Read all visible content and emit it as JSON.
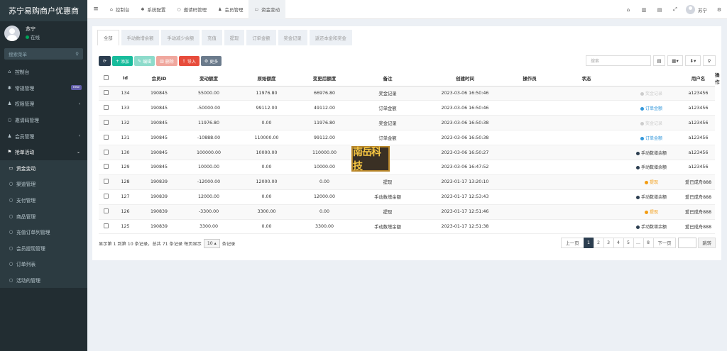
{
  "brand": "苏宁易购商户优惠商",
  "user": {
    "name": "苏宁",
    "status": "在线"
  },
  "search_placeholder": "搜索菜单",
  "menu": [
    {
      "icon": "⌂",
      "label": "控制台"
    },
    {
      "icon": "✱",
      "label": "常规管理",
      "badge": "new"
    },
    {
      "icon": "♟",
      "label": "权限管理",
      "chev": "‹"
    },
    {
      "icon": "○",
      "label": "邀请码管理"
    },
    {
      "icon": "♟",
      "label": "会员管理",
      "chev": "‹"
    },
    {
      "icon": "⚑",
      "label": "抢单活动",
      "chev": "⌄"
    },
    {
      "icon": "▭",
      "label": "资金变动"
    },
    {
      "icon": "○",
      "label": "渠道管理"
    },
    {
      "icon": "○",
      "label": "支付管理"
    },
    {
      "icon": "○",
      "label": "商品管理"
    },
    {
      "icon": "○",
      "label": "充值订单列管理"
    },
    {
      "icon": "○",
      "label": "会员提现管理"
    },
    {
      "icon": "○",
      "label": "订单列表"
    },
    {
      "icon": "○",
      "label": "活动的管理"
    }
  ],
  "topnav": [
    {
      "icon": "⌂",
      "label": "控制台"
    },
    {
      "icon": "✱",
      "label": "系统配置"
    },
    {
      "icon": "○",
      "label": "邀请码管理"
    },
    {
      "icon": "♟",
      "label": "会员管理"
    },
    {
      "icon": "▭",
      "label": "资金变动"
    }
  ],
  "topright": {
    "icons": [
      "home-icon",
      "trash-icon",
      "comment-icon",
      "expand-icon"
    ],
    "username": "苏宁",
    "gear": "cog-icon"
  },
  "tabs": [
    "全部",
    "手动数增余额",
    "手动减少余额",
    "充值",
    "提现",
    "订单金额",
    "奖金记录",
    "返还本金和奖金"
  ],
  "toolbar": {
    "add": "添加",
    "edit": "编辑",
    "delete": "删除",
    "import": "导入",
    "more": "更多"
  },
  "table_search_placeholder": "搜索",
  "columns": [
    "Id",
    "会员ID",
    "变动额度",
    "原始额度",
    "变更后额度",
    "备注",
    "创建时间",
    "操作员",
    "状态",
    "用户名",
    "操作"
  ],
  "rows": [
    {
      "id": "134",
      "uid": "190845",
      "change": "55000.00",
      "orig": "11976.80",
      "after": "66976.80",
      "note": "奖金记录",
      "time": "2023-03-06 16:50:46",
      "op": "",
      "status": "奖金记录",
      "stype": "gray",
      "user": "a123456"
    },
    {
      "id": "133",
      "uid": "190845",
      "change": "-50000.00",
      "orig": "99112.00",
      "after": "49112.00",
      "note": "订单金额",
      "time": "2023-03-06 16:50:46",
      "op": "",
      "status": "订单金额",
      "stype": "blue",
      "user": "a123456"
    },
    {
      "id": "132",
      "uid": "190845",
      "change": "11976.80",
      "orig": "0.00",
      "after": "11976.80",
      "note": "奖金记录",
      "time": "2023-03-06 16:50:38",
      "op": "",
      "status": "奖金记录",
      "stype": "gray",
      "user": "a123456"
    },
    {
      "id": "131",
      "uid": "190845",
      "change": "-10888.00",
      "orig": "110000.00",
      "after": "99112.00",
      "note": "订单金额",
      "time": "2023-03-06 16:50:38",
      "op": "",
      "status": "订单金额",
      "stype": "blue",
      "user": "a123456"
    },
    {
      "id": "130",
      "uid": "190845",
      "change": "100000.00",
      "orig": "10000.00",
      "after": "110000.00",
      "note": "",
      "time": "2023-03-06 16:50:27",
      "op": "",
      "status": "手动数增余额",
      "stype": "dark",
      "user": "a123456"
    },
    {
      "id": "129",
      "uid": "190845",
      "change": "10000.00",
      "orig": "0.00",
      "after": "10000.00",
      "note": "",
      "time": "2023-03-06 16:47:52",
      "op": "",
      "status": "手动数增余额",
      "stype": "dark",
      "user": "a123456"
    },
    {
      "id": "128",
      "uid": "190839",
      "change": "-12000.00",
      "orig": "12000.00",
      "after": "0.00",
      "note": "提现",
      "time": "2023-01-17 13:20:10",
      "op": "",
      "status": "提现",
      "stype": "orange",
      "user": "爱已成舟888"
    },
    {
      "id": "127",
      "uid": "190839",
      "change": "12000.00",
      "orig": "0.00",
      "after": "12000.00",
      "note": "手动数增余额",
      "time": "2023-01-17 12:53:43",
      "op": "",
      "status": "手动数增余额",
      "stype": "dark",
      "user": "爱已成舟888"
    },
    {
      "id": "126",
      "uid": "190839",
      "change": "-3300.00",
      "orig": "3300.00",
      "after": "0.00",
      "note": "提现",
      "time": "2023-01-17 12:51:46",
      "op": "",
      "status": "提现",
      "stype": "orange",
      "user": "爱已成舟888"
    },
    {
      "id": "125",
      "uid": "190839",
      "change": "3300.00",
      "orig": "0.00",
      "after": "3300.00",
      "note": "手动数增余额",
      "time": "2023-01-17 12:51:38",
      "op": "",
      "status": "手动数增余额",
      "stype": "dark",
      "user": "爱已成舟888"
    }
  ],
  "status_colors": {
    "gray": "#cccccc",
    "blue": "#3498db",
    "dark": "#2c3e50",
    "orange": "#f39c12"
  },
  "footer": {
    "pre": "显示第 1 到第 10 条记录，总共 71 条记录 每页显示",
    "pagesize": "10",
    "post": "条记录"
  },
  "pager": {
    "prev": "上一页",
    "pages": [
      "1",
      "2",
      "3",
      "4",
      "5",
      "...",
      "8"
    ],
    "next": "下一页",
    "jump": "跳转"
  },
  "watermark": "南岳科技"
}
